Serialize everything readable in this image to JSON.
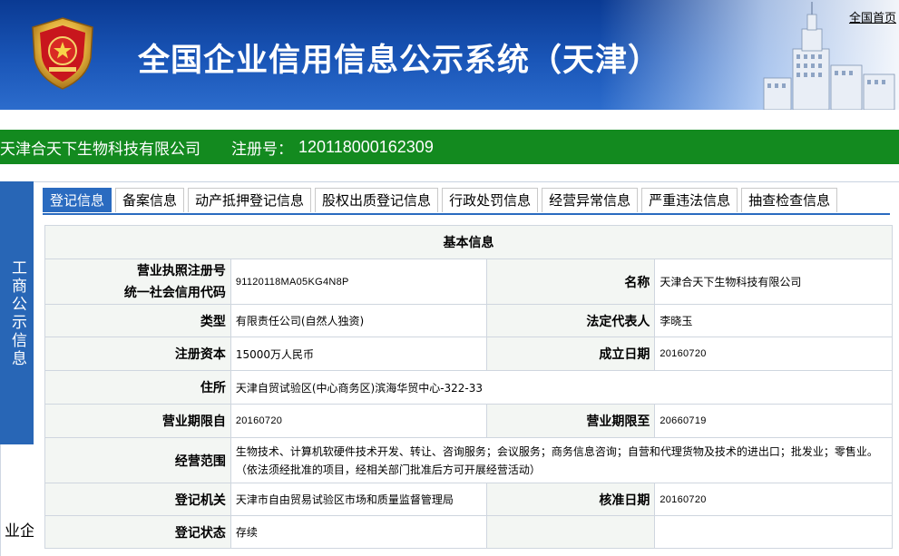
{
  "header": {
    "site_title": "全国企业信用信息公示系统（天津）",
    "home_link": "全国首页",
    "colors": {
      "banner_dark": "#0a3a93",
      "banner_light": "#2c6ccc"
    },
    "icons": [
      "national-emblem-icon",
      "building-tower-icon"
    ]
  },
  "company_bar": {
    "name": "天津合天下生物科技有限公司",
    "reg_label": "注册号：",
    "reg_no": "120118000162309",
    "color": "#138a1f"
  },
  "side_tabs": [
    {
      "label": "工商公示信息",
      "active": true
    },
    {
      "label": "企业",
      "active": false
    }
  ],
  "tabs": [
    {
      "label": "登记信息",
      "active": true
    },
    {
      "label": "备案信息",
      "active": false
    },
    {
      "label": "动产抵押登记信息",
      "active": false
    },
    {
      "label": "股权出质登记信息",
      "active": false
    },
    {
      "label": "行政处罚信息",
      "active": false
    },
    {
      "label": "经营异常信息",
      "active": false
    },
    {
      "label": "严重违法信息",
      "active": false
    },
    {
      "label": "抽查检查信息",
      "active": false
    }
  ],
  "basic_info": {
    "title": "基本信息",
    "license_label": "营业执照注册号",
    "license_value": "",
    "credit_code_label": "统一社会信用代码",
    "credit_code_value": "91120118MA05KG4N8P",
    "name_label": "名称",
    "name_value": "天津合天下生物科技有限公司",
    "type_label": "类型",
    "type_value": "有限责任公司(自然人独资)",
    "legal_rep_label": "法定代表人",
    "legal_rep_value": "李晓玉",
    "capital_label": "注册资本",
    "capital_value": "15000万人民币",
    "established_label": "成立日期",
    "established_value": "20160720",
    "address_label": "住所",
    "address_value": "天津自贸试验区(中心商务区)滨海华贸中心-322-33",
    "term_from_label": "营业期限自",
    "term_from_value": "20160720",
    "term_to_label": "营业期限至",
    "term_to_value": "20660719",
    "scope_label": "经营范围",
    "scope_line1": "生物技术、计算机软硬件技术开发、转让、咨询服务；会议服务；商务信息咨询；自营和代理货物及技术的进出口；批发业；零售业。",
    "scope_line2": "（依法须经批准的项目，经相关部门批准后方可开展经营活动）",
    "authority_label": "登记机关",
    "authority_value": "天津市自由贸易试验区市场和质量监督管理局",
    "approval_label": "核准日期",
    "approval_value": "20160720",
    "status_label": "登记状态",
    "status_value": "存续"
  }
}
